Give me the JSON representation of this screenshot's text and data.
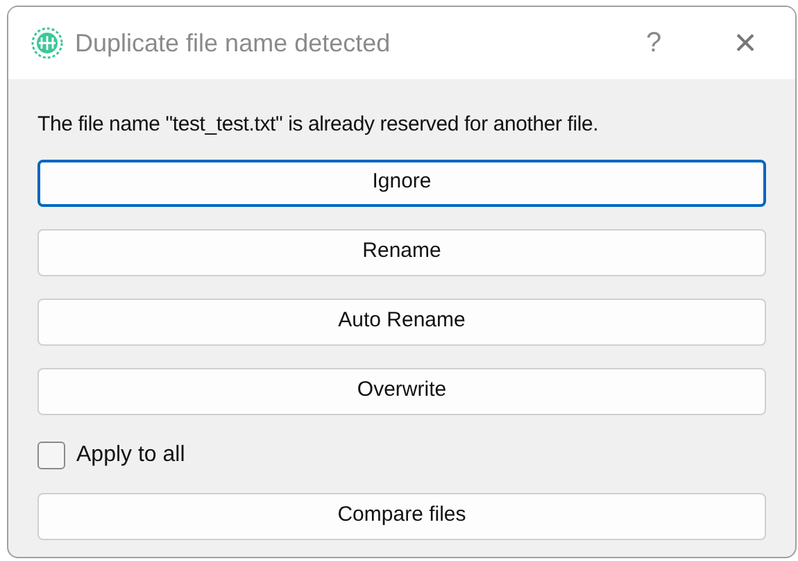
{
  "window": {
    "title": "Duplicate file name detected",
    "help": "?",
    "close": "×"
  },
  "message": "The file name \"test_test.txt\" is already reserved for another file.",
  "buttons": [
    {
      "label": "Ignore",
      "focused": true
    },
    {
      "label": "Rename",
      "focused": false
    },
    {
      "label": "Auto Rename",
      "focused": false
    },
    {
      "label": "Overwrite",
      "focused": false
    }
  ],
  "apply_to_all": {
    "label": "Apply to all",
    "checked": false
  },
  "compare_button": {
    "label": "Compare files"
  }
}
